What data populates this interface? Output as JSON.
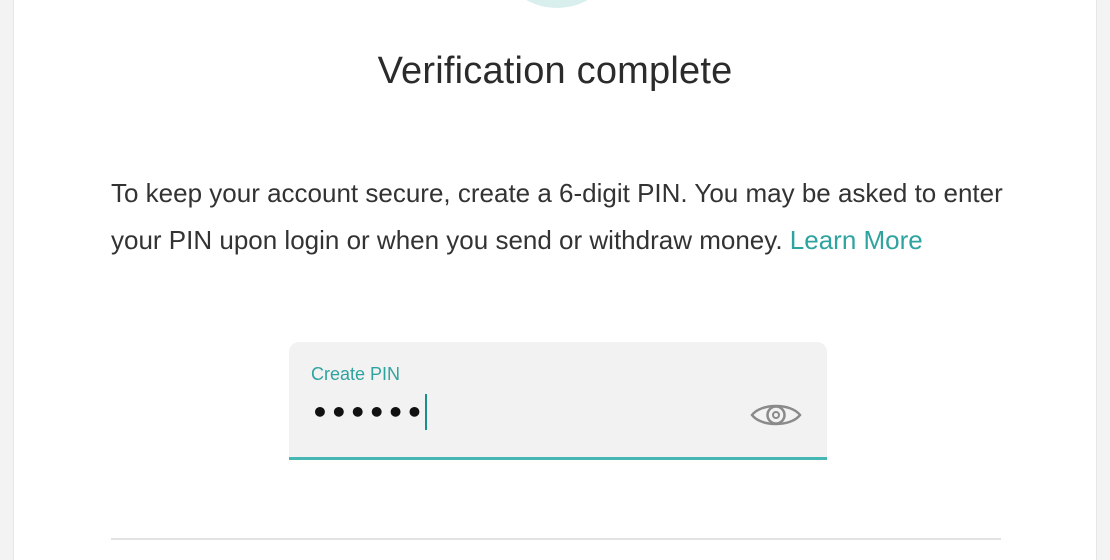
{
  "header": {
    "title": "Verification complete"
  },
  "description": {
    "text": "To keep your account secure, create a 6-digit PIN. You may be asked to enter your PIN upon login or when you send or withdraw money.",
    "learn_more_label": "Learn More"
  },
  "pin_field": {
    "label": "Create PIN",
    "value_masked": "••••••",
    "icon": "eye-icon"
  },
  "colors": {
    "accent": "#2fa3a0",
    "underline": "#47b7b3",
    "field_background": "#f2f2f2",
    "success_circle": "#d9efee"
  }
}
